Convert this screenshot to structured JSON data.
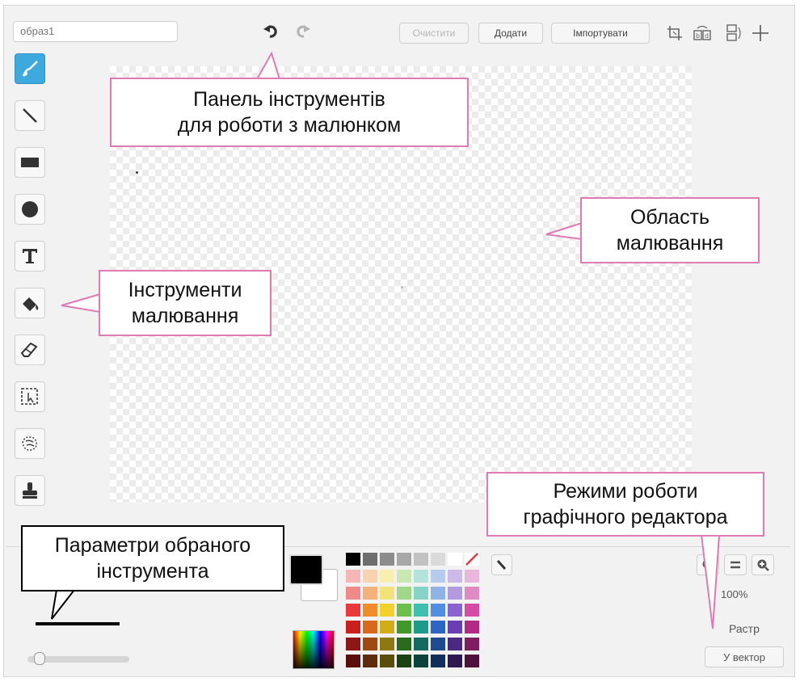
{
  "costume_name": "образ1",
  "toolbar": {
    "clear_label": "Очистити",
    "add_label": "Додати",
    "import_label": "Імпортувати"
  },
  "zoom": {
    "level": "100%"
  },
  "mode": {
    "current": "Растр",
    "convert_label": "У вектор"
  },
  "annotations": {
    "toolbar_panel": [
      "Панель інструментів",
      "для роботи з малюнком"
    ],
    "drawing_area": [
      "Область",
      "малювання"
    ],
    "drawing_tools": [
      "Інструменти",
      "малювання"
    ],
    "editor_modes": [
      "Режими роботи",
      "графічного редактора"
    ],
    "tool_params": [
      "Параметри обраного",
      "інструмента"
    ]
  },
  "colors": {
    "accent": "#3ea9dc",
    "callout_border": "#e07ab3",
    "primary_color": "#000000",
    "secondary_color": "#ffffff"
  },
  "palette": [
    [
      "#000000",
      "#6e6e6e",
      "#8c8c8c",
      "#a8a8a8",
      "#c2c2c2",
      "#dadada",
      "#ffffff",
      "#ffffff"
    ],
    [
      "#f4b6b6",
      "#f7d3b0",
      "#f7eeb0",
      "#c9e8b4",
      "#b4e3dc",
      "#b4cdee",
      "#cdb9ea",
      "#eab6db"
    ],
    [
      "#ef8a8a",
      "#f4b27a",
      "#f2e27c",
      "#9fd88a",
      "#86d4c8",
      "#8eb4e6",
      "#b39ae0",
      "#e08ac4"
    ],
    [
      "#e83a3a",
      "#f08c2a",
      "#f2d22a",
      "#6cc04a",
      "#3fbfae",
      "#4f8ee0",
      "#8a63cf",
      "#d64aa6"
    ],
    [
      "#c91f1f",
      "#d8681a",
      "#cfae1a",
      "#3f9a2a",
      "#1e9a8a",
      "#2c66c4",
      "#6a3fb3",
      "#b22a86"
    ],
    [
      "#8e1616",
      "#9c4a12",
      "#8e7812",
      "#2a6a1c",
      "#146a60",
      "#1e4a8e",
      "#4a2a80",
      "#7e1e60"
    ],
    [
      "#5a0e0e",
      "#5e2c0c",
      "#5a4c0c",
      "#1a4212",
      "#0c423c",
      "#122e5a",
      "#2e1a50",
      "#4e123c"
    ]
  ]
}
